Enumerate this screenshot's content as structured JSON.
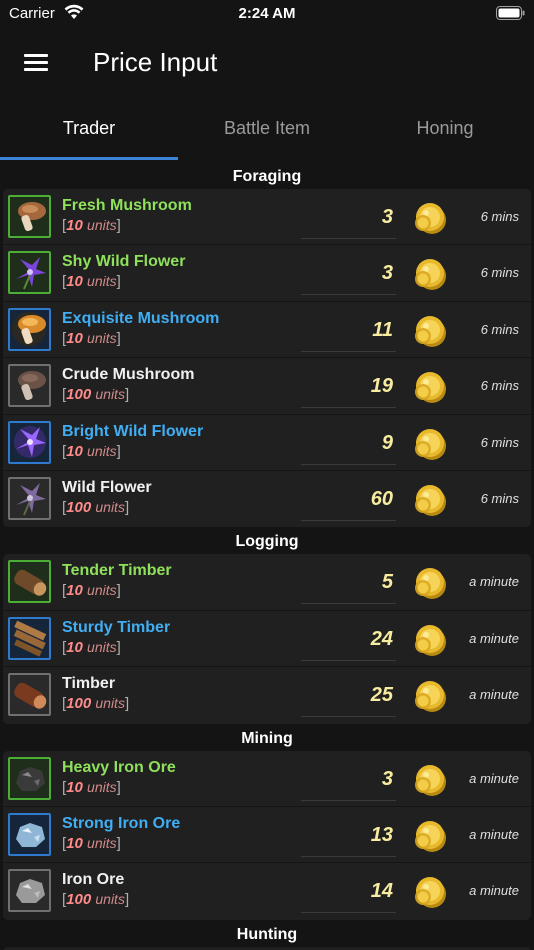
{
  "status": {
    "carrier": "Carrier",
    "time": "2:24 AM"
  },
  "nav": {
    "title": "Price Input"
  },
  "tabs": [
    {
      "label": "Trader"
    },
    {
      "label": "Battle Item"
    },
    {
      "label": "Honing"
    }
  ],
  "sections": [
    {
      "title": "Foraging",
      "items": [
        {
          "name": "Fresh Mushroom",
          "rarity": "green",
          "units": "10",
          "price": "3",
          "time": "6 mins"
        },
        {
          "name": "Shy Wild Flower",
          "rarity": "green",
          "units": "10",
          "price": "3",
          "time": "6 mins"
        },
        {
          "name": "Exquisite Mushroom",
          "rarity": "blue",
          "units": "10",
          "price": "11",
          "time": "6 mins"
        },
        {
          "name": "Crude Mushroom",
          "rarity": "white",
          "units": "100",
          "price": "19",
          "time": "6 mins"
        },
        {
          "name": "Bright Wild Flower",
          "rarity": "blue",
          "units": "10",
          "price": "9",
          "time": "6 mins"
        },
        {
          "name": "Wild Flower",
          "rarity": "white",
          "units": "100",
          "price": "60",
          "time": "6 mins"
        }
      ]
    },
    {
      "title": "Logging",
      "items": [
        {
          "name": "Tender Timber",
          "rarity": "green",
          "units": "10",
          "price": "5",
          "time": "a minute"
        },
        {
          "name": "Sturdy Timber",
          "rarity": "blue",
          "units": "10",
          "price": "24",
          "time": "a minute"
        },
        {
          "name": "Timber",
          "rarity": "white",
          "units": "100",
          "price": "25",
          "time": "a minute"
        }
      ]
    },
    {
      "title": "Mining",
      "items": [
        {
          "name": "Heavy Iron Ore",
          "rarity": "green",
          "units": "10",
          "price": "3",
          "time": "a minute"
        },
        {
          "name": "Strong Iron Ore",
          "rarity": "blue",
          "units": "10",
          "price": "13",
          "time": "a minute"
        },
        {
          "name": "Iron Ore",
          "rarity": "white",
          "units": "100",
          "price": "14",
          "time": "a minute"
        }
      ]
    },
    {
      "title": "Hunting",
      "items": []
    }
  ],
  "units_label": "units",
  "colors": {
    "green": "#8fe05a",
    "blue": "#41aef3",
    "accent": "#3d83d6",
    "price": "#f7eca0"
  }
}
